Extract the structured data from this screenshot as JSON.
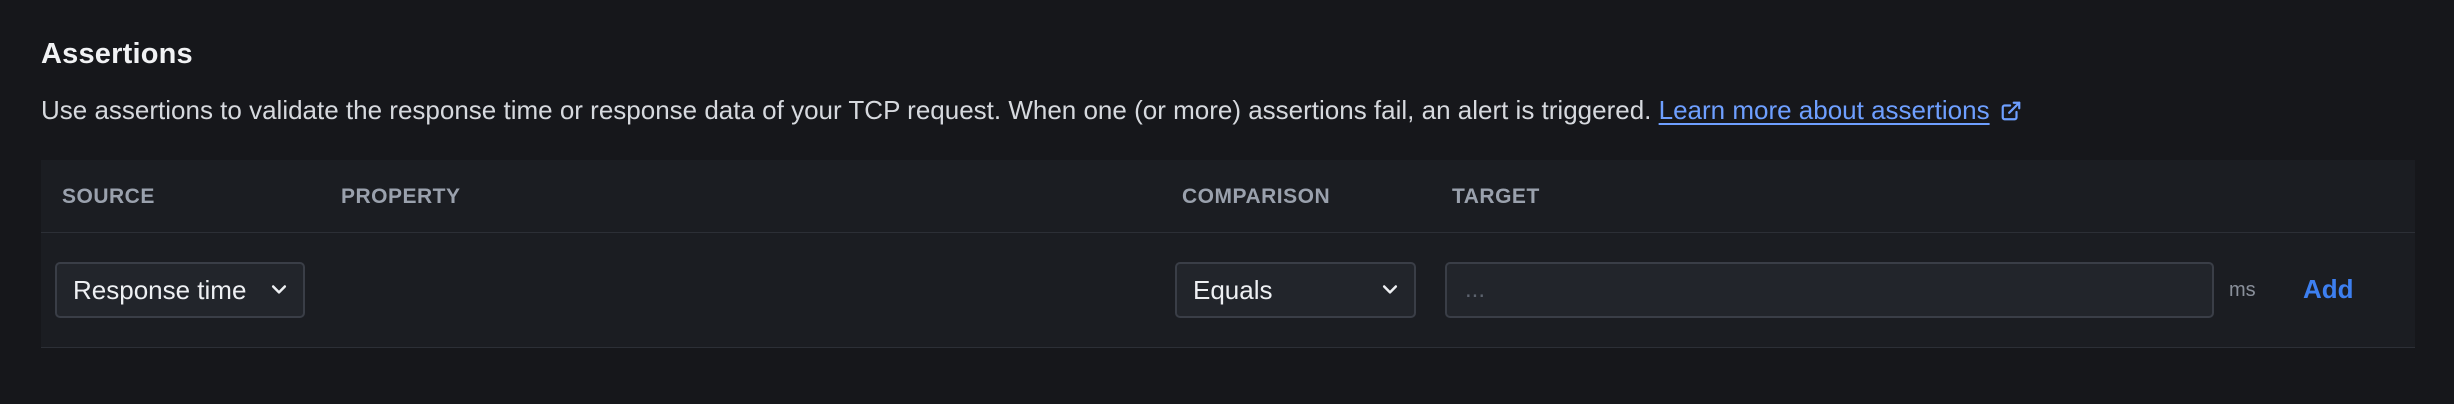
{
  "section": {
    "title": "Assertions",
    "description": "Use assertions to validate the response time or response data of your TCP request. When one (or more) assertions fail, an alert is triggered.",
    "learn_more_link": "Learn more about assertions",
    "learn_more_icon": "external-link-icon"
  },
  "table": {
    "headers": {
      "source": "SOURCE",
      "property": "PROPERTY",
      "comparison": "COMPARISON",
      "target": "TARGET"
    },
    "row": {
      "source_value": "Response time",
      "comparison_value": "Equals",
      "target_placeholder": "...",
      "target_value": "",
      "unit": "ms",
      "add_label": "Add"
    }
  },
  "colors": {
    "background": "#16171b",
    "table_background": "#1b1d22",
    "link": "#6e9fff",
    "add_button": "#3d7ff0"
  }
}
